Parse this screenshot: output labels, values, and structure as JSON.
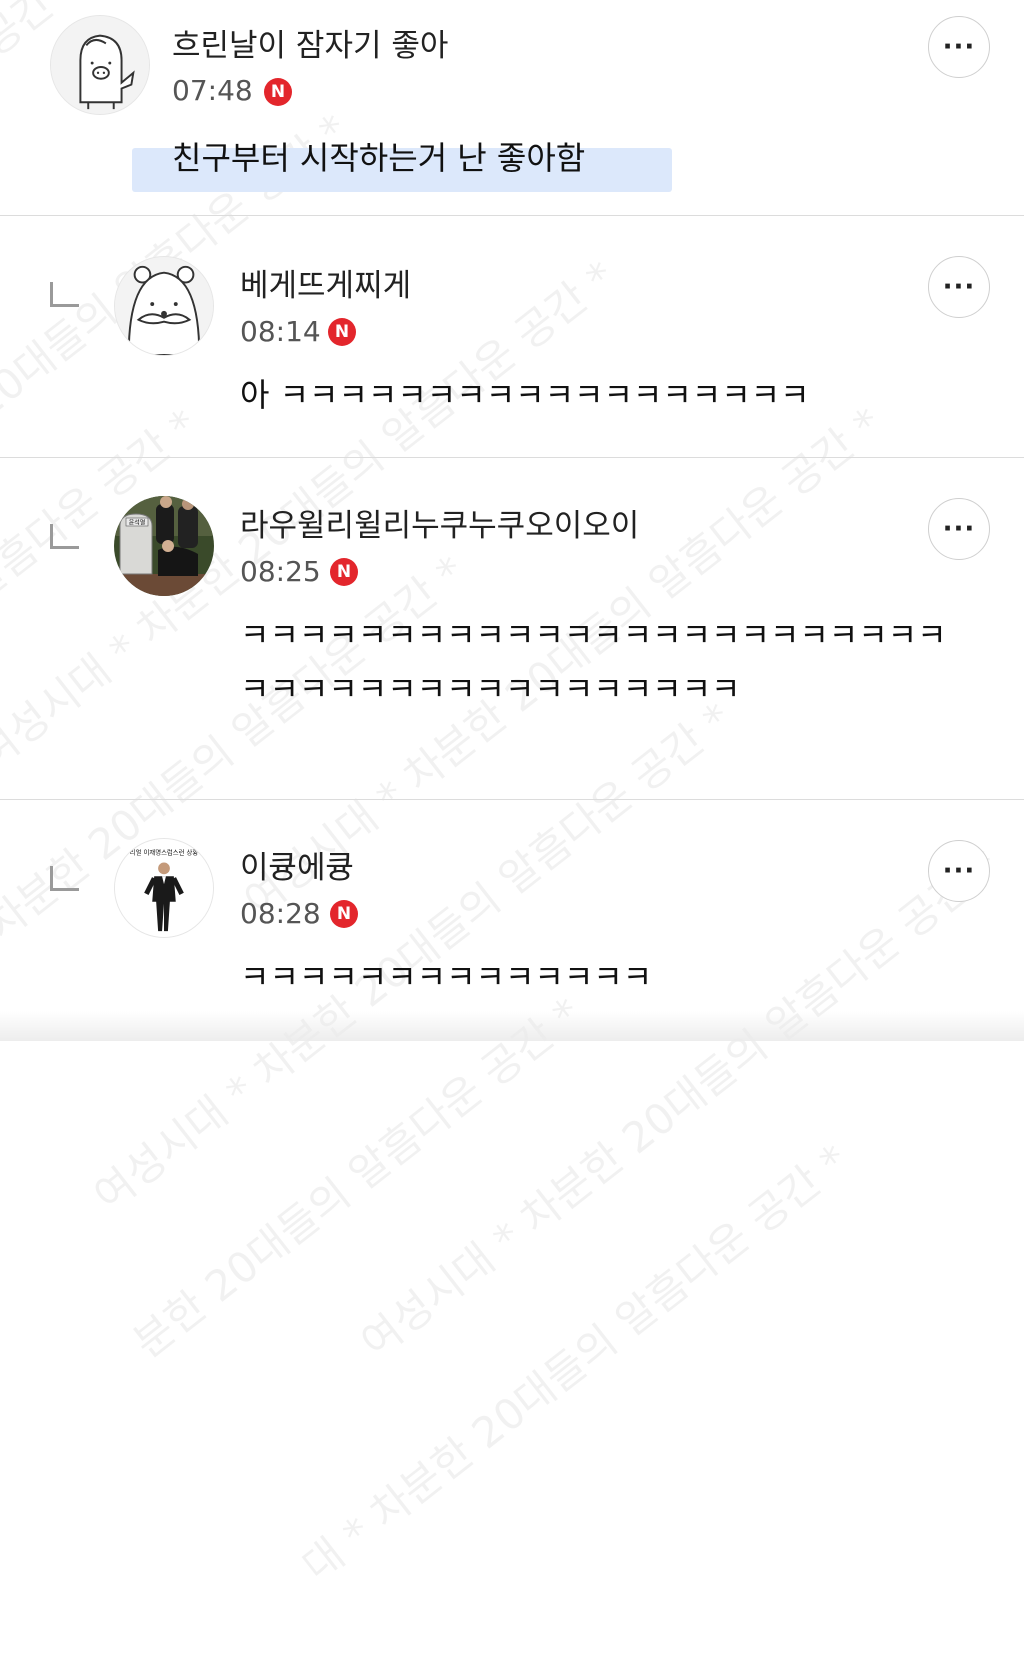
{
  "watermark": "여성시대 * 차분한 20대들의 알흠다운 공간 *",
  "comments": [
    {
      "author": "흐린날이 잠자기 좋아",
      "time": "07:48",
      "badge": "N",
      "text": "친구부터 시작하는거 난 좋아함",
      "highlighted": true,
      "avatar": "ghost-penguin-avatar",
      "more_label": "···"
    },
    {
      "author": "베게뜨게찌게",
      "time": "08:14",
      "badge": "N",
      "text": "아 ㅋㅋㅋㅋㅋㅋㅋㅋㅋㅋㅋㅋㅋㅋㅋㅋㅋㅋ",
      "reply": true,
      "avatar": "mustache-hamster-avatar",
      "more_label": "···"
    },
    {
      "author": "라우윌리윌리누쿠누쿠오이오이",
      "time": "08:25",
      "badge": "N",
      "text": "ㅋㅋㅋㅋㅋㅋㅋㅋㅋㅋㅋㅋㅋㅋㅋㅋㅋㅋㅋㅋㅋㅋㅋㅋㅋㅋㅋㅋㅋㅋㅋㅋㅋㅋㅋㅋㅋㅋㅋㅋㅋ",
      "reply": true,
      "avatar": "grave-photo-avatar",
      "avatar_caption": "윤석열",
      "more_label": "···"
    },
    {
      "author": "이큥에큥",
      "time": "08:28",
      "badge": "N",
      "text": "ㅋㅋㅋㅋㅋㅋㅋㅋㅋㅋㅋㅋㅋㅋ",
      "reply": true,
      "avatar": "suit-man-avatar",
      "avatar_caption": "리얼 이재명스럽스런 상황",
      "more_label": "···"
    }
  ]
}
